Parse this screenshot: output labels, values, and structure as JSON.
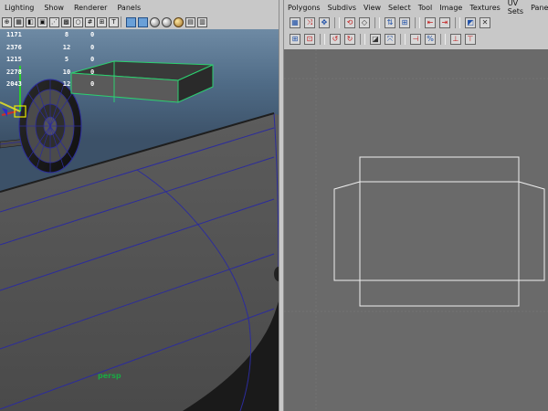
{
  "left_panel": {
    "menu": [
      "Lighting",
      "Show",
      "Renderer",
      "Panels"
    ],
    "toolbar_icons": [
      "select-camera-icon",
      "wireframe-icon",
      "smooth-shade-icon",
      "bounding-box-icon",
      "points-icon",
      "texture-icon",
      "isolate-icon",
      "grid-icon",
      "film-gate-icon",
      "shaded-icon",
      "wire-on-shaded-icon",
      "default-material-icon",
      "lights-icon",
      "xray-icon",
      "resolution-gate-icon"
    ],
    "stats": [
      [
        "1171",
        "8",
        "0"
      ],
      [
        "2376",
        "12",
        "0"
      ],
      [
        "1215",
        "5",
        "0"
      ],
      [
        "2278",
        "10",
        "0"
      ],
      [
        "2043",
        "12",
        "0"
      ]
    ],
    "camera_label": "persp"
  },
  "right_panel": {
    "menu": [
      "Polygons",
      "Subdivs",
      "View",
      "Select",
      "Tool",
      "Image",
      "Textures",
      "UV Sets",
      "Panels"
    ],
    "toolbar_icons_row1": [
      "uv-snapshot-icon",
      "move-uv-icon",
      "unfold-icon",
      "rotate-uv-ccw-icon",
      "rotate-uv-cw-icon",
      "flip-u-icon",
      "flip-v-icon",
      "stack-icon",
      "align-icon",
      "cut-uv-icon",
      "sew-uv-icon",
      "move-and-sew-icon",
      "display-image-icon",
      "checker-icon"
    ],
    "toolbar_icons_row2": [
      "grid-view-icon",
      "frame-all-icon",
      "rotate-left-icon",
      "rotate-right-icon",
      "cut-icon",
      "straighten-icon",
      "layout-icon",
      "split-icon",
      "merge-icon",
      "delete-icon"
    ]
  },
  "colors": {
    "panel_bg": "#c8c8c8",
    "viewport_top": "#6e8aa4",
    "mesh_surface": "#585858",
    "edge_blue": "#2c2c9c",
    "selection_green": "#2cd070",
    "uv_background": "#6a6a6a",
    "uv_lines": "#f0f0f0",
    "camera_label_color": "#1aa844"
  }
}
